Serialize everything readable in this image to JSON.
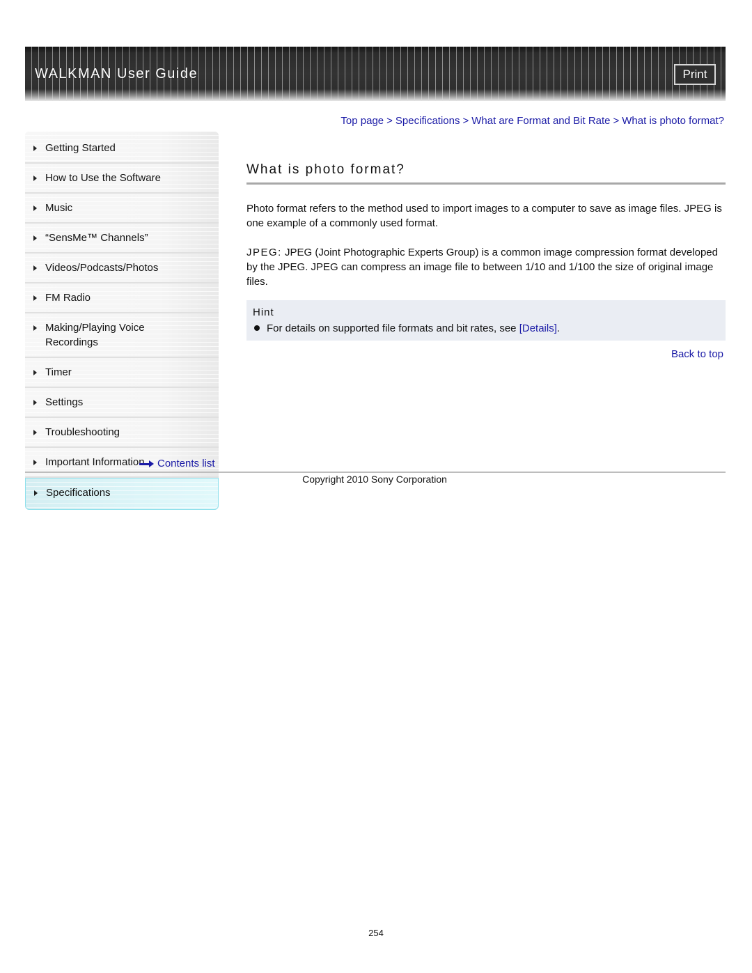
{
  "header": {
    "title": "WALKMAN User Guide",
    "print_label": "Print"
  },
  "breadcrumb": [
    {
      "label": "Top page"
    },
    {
      "label": "Specifications"
    },
    {
      "label": "What are Format and Bit Rate"
    },
    {
      "label": "What is photo format?"
    }
  ],
  "breadcrumb_separator": ">",
  "sidebar": {
    "items": [
      {
        "label": "Getting Started"
      },
      {
        "label": "How to Use the Software"
      },
      {
        "label": "Music"
      },
      {
        "label": "“SensMe™ Channels”"
      },
      {
        "label": "Videos/Podcasts/Photos"
      },
      {
        "label": "FM Radio"
      },
      {
        "label": "Making/Playing Voice Recordings"
      },
      {
        "label": "Timer"
      },
      {
        "label": "Settings"
      },
      {
        "label": "Troubleshooting"
      },
      {
        "label": "Important Information"
      },
      {
        "label": "Specifications",
        "active": true
      }
    ],
    "contents_list_label": "Contents list",
    "active_color": "#d9f4f8"
  },
  "main": {
    "title": "What is photo format?",
    "paragraph1": "Photo format refers to the method used to import images to a computer to save as image files. JPEG is one example of a commonly used format.",
    "paragraph2_term": "JPEG:",
    "paragraph2_text": " JPEG (Joint Photographic Experts Group) is a common image compression format developed by the JPEG. JPEG can compress an image file to between 1/10 and 1/100 the size of original image files.",
    "hint": {
      "label": "Hint",
      "text_before": "For details on supported file formats and bit rates, see ",
      "link_label": "[Details]",
      "text_after": "."
    },
    "back_to_top_label": "Back to top"
  },
  "footer": {
    "copyright": "Copyright 2010 Sony Corporation",
    "page_number": "254"
  },
  "colors": {
    "link": "#1a1aa6",
    "hint_background": "#eaedf3",
    "banner": "#333333"
  }
}
